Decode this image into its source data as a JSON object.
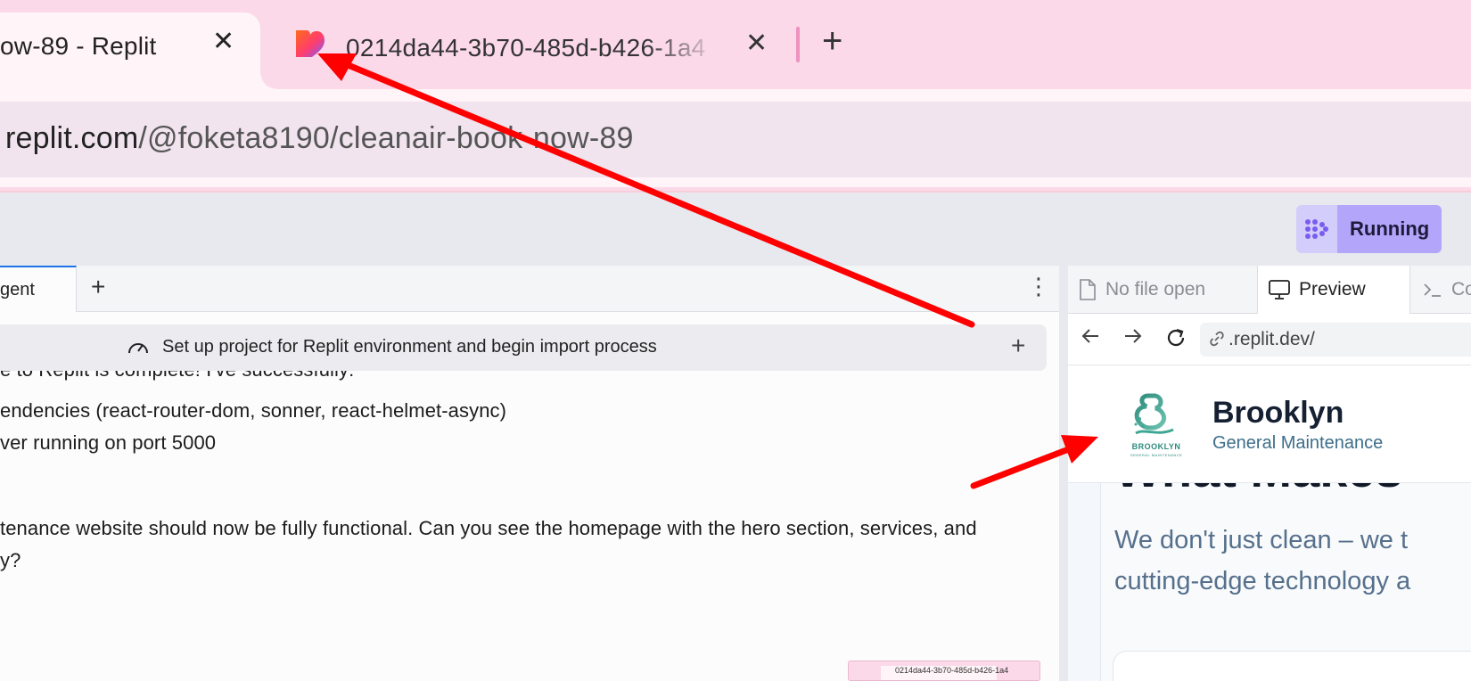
{
  "browser": {
    "tabs": [
      {
        "title": "ow-89 - Replit",
        "close": "✕"
      },
      {
        "title": "0214da44-3b70-485d-b426-1a4",
        "close": "✕"
      }
    ],
    "new_tab": "+",
    "url_host": "replit.com",
    "url_path": "/@foketa8190/cleanair-book-now-89"
  },
  "replit": {
    "run_button": "Running",
    "agent_tab": "gent",
    "add_tab": "+",
    "task_title": "Set up project for Replit environment and begin import process",
    "task_plus": "+",
    "messages": [
      "e to Replit is complete! I've successfully:",
      "endencies (react-router-dom, sonner, react-helmet-async)",
      "ver running on port 5000",
      "tenance website should now be fully functional. Can you see the homepage with the hero section, services, and",
      "y?"
    ],
    "menu": "⋮"
  },
  "preview_panel": {
    "tabs": {
      "no_file": "No file open",
      "preview": "Preview",
      "console": "Co"
    },
    "url": ".replit.dev/",
    "site": {
      "brand_name": "Brooklyn",
      "brand_sub": "General Maintenance",
      "logo_text": "BROOKLYN",
      "logo_sub": "GENERAL MAINTENANCE",
      "hero_heading": "What Makes",
      "hero_lines": [
        "We don't just clean – we t",
        "cutting-edge technology a"
      ]
    }
  },
  "thumbnail": {
    "title": "0214da44-3b70-485d-b426-1a4"
  },
  "colors": {
    "tab_strip": "#fbd9e9",
    "run_button": "#b3a5fa",
    "annotation_arrow": "#ff0000",
    "brand_teal": "#2e8b7d"
  }
}
